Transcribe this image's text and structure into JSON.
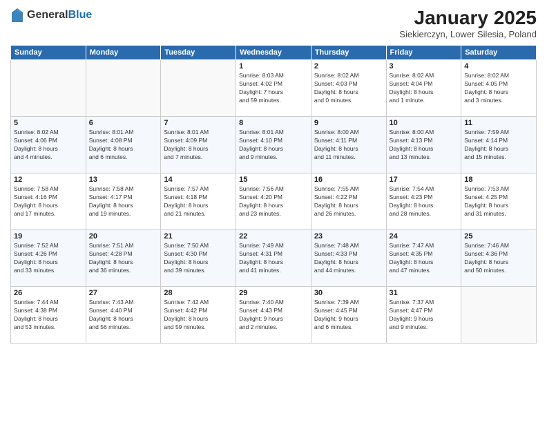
{
  "header": {
    "logo_general": "General",
    "logo_blue": "Blue",
    "month_title": "January 2025",
    "subtitle": "Siekierczyn, Lower Silesia, Poland"
  },
  "days_of_week": [
    "Sunday",
    "Monday",
    "Tuesday",
    "Wednesday",
    "Thursday",
    "Friday",
    "Saturday"
  ],
  "weeks": [
    [
      {
        "day": "",
        "info": ""
      },
      {
        "day": "",
        "info": ""
      },
      {
        "day": "",
        "info": ""
      },
      {
        "day": "1",
        "info": "Sunrise: 8:03 AM\nSunset: 4:02 PM\nDaylight: 7 hours\nand 59 minutes."
      },
      {
        "day": "2",
        "info": "Sunrise: 8:02 AM\nSunset: 4:03 PM\nDaylight: 8 hours\nand 0 minutes."
      },
      {
        "day": "3",
        "info": "Sunrise: 8:02 AM\nSunset: 4:04 PM\nDaylight: 8 hours\nand 1 minute."
      },
      {
        "day": "4",
        "info": "Sunrise: 8:02 AM\nSunset: 4:05 PM\nDaylight: 8 hours\nand 3 minutes."
      }
    ],
    [
      {
        "day": "5",
        "info": "Sunrise: 8:02 AM\nSunset: 4:06 PM\nDaylight: 8 hours\nand 4 minutes."
      },
      {
        "day": "6",
        "info": "Sunrise: 8:01 AM\nSunset: 4:08 PM\nDaylight: 8 hours\nand 6 minutes."
      },
      {
        "day": "7",
        "info": "Sunrise: 8:01 AM\nSunset: 4:09 PM\nDaylight: 8 hours\nand 7 minutes."
      },
      {
        "day": "8",
        "info": "Sunrise: 8:01 AM\nSunset: 4:10 PM\nDaylight: 8 hours\nand 9 minutes."
      },
      {
        "day": "9",
        "info": "Sunrise: 8:00 AM\nSunset: 4:11 PM\nDaylight: 8 hours\nand 11 minutes."
      },
      {
        "day": "10",
        "info": "Sunrise: 8:00 AM\nSunset: 4:13 PM\nDaylight: 8 hours\nand 13 minutes."
      },
      {
        "day": "11",
        "info": "Sunrise: 7:59 AM\nSunset: 4:14 PM\nDaylight: 8 hours\nand 15 minutes."
      }
    ],
    [
      {
        "day": "12",
        "info": "Sunrise: 7:58 AM\nSunset: 4:16 PM\nDaylight: 8 hours\nand 17 minutes."
      },
      {
        "day": "13",
        "info": "Sunrise: 7:58 AM\nSunset: 4:17 PM\nDaylight: 8 hours\nand 19 minutes."
      },
      {
        "day": "14",
        "info": "Sunrise: 7:57 AM\nSunset: 4:18 PM\nDaylight: 8 hours\nand 21 minutes."
      },
      {
        "day": "15",
        "info": "Sunrise: 7:56 AM\nSunset: 4:20 PM\nDaylight: 8 hours\nand 23 minutes."
      },
      {
        "day": "16",
        "info": "Sunrise: 7:55 AM\nSunset: 4:22 PM\nDaylight: 8 hours\nand 26 minutes."
      },
      {
        "day": "17",
        "info": "Sunrise: 7:54 AM\nSunset: 4:23 PM\nDaylight: 8 hours\nand 28 minutes."
      },
      {
        "day": "18",
        "info": "Sunrise: 7:53 AM\nSunset: 4:25 PM\nDaylight: 8 hours\nand 31 minutes."
      }
    ],
    [
      {
        "day": "19",
        "info": "Sunrise: 7:52 AM\nSunset: 4:26 PM\nDaylight: 8 hours\nand 33 minutes."
      },
      {
        "day": "20",
        "info": "Sunrise: 7:51 AM\nSunset: 4:28 PM\nDaylight: 8 hours\nand 36 minutes."
      },
      {
        "day": "21",
        "info": "Sunrise: 7:50 AM\nSunset: 4:30 PM\nDaylight: 8 hours\nand 39 minutes."
      },
      {
        "day": "22",
        "info": "Sunrise: 7:49 AM\nSunset: 4:31 PM\nDaylight: 8 hours\nand 41 minutes."
      },
      {
        "day": "23",
        "info": "Sunrise: 7:48 AM\nSunset: 4:33 PM\nDaylight: 8 hours\nand 44 minutes."
      },
      {
        "day": "24",
        "info": "Sunrise: 7:47 AM\nSunset: 4:35 PM\nDaylight: 8 hours\nand 47 minutes."
      },
      {
        "day": "25",
        "info": "Sunrise: 7:46 AM\nSunset: 4:36 PM\nDaylight: 8 hours\nand 50 minutes."
      }
    ],
    [
      {
        "day": "26",
        "info": "Sunrise: 7:44 AM\nSunset: 4:38 PM\nDaylight: 8 hours\nand 53 minutes."
      },
      {
        "day": "27",
        "info": "Sunrise: 7:43 AM\nSunset: 4:40 PM\nDaylight: 8 hours\nand 56 minutes."
      },
      {
        "day": "28",
        "info": "Sunrise: 7:42 AM\nSunset: 4:42 PM\nDaylight: 8 hours\nand 59 minutes."
      },
      {
        "day": "29",
        "info": "Sunrise: 7:40 AM\nSunset: 4:43 PM\nDaylight: 9 hours\nand 2 minutes."
      },
      {
        "day": "30",
        "info": "Sunrise: 7:39 AM\nSunset: 4:45 PM\nDaylight: 9 hours\nand 6 minutes."
      },
      {
        "day": "31",
        "info": "Sunrise: 7:37 AM\nSunset: 4:47 PM\nDaylight: 9 hours\nand 9 minutes."
      },
      {
        "day": "",
        "info": ""
      }
    ]
  ]
}
